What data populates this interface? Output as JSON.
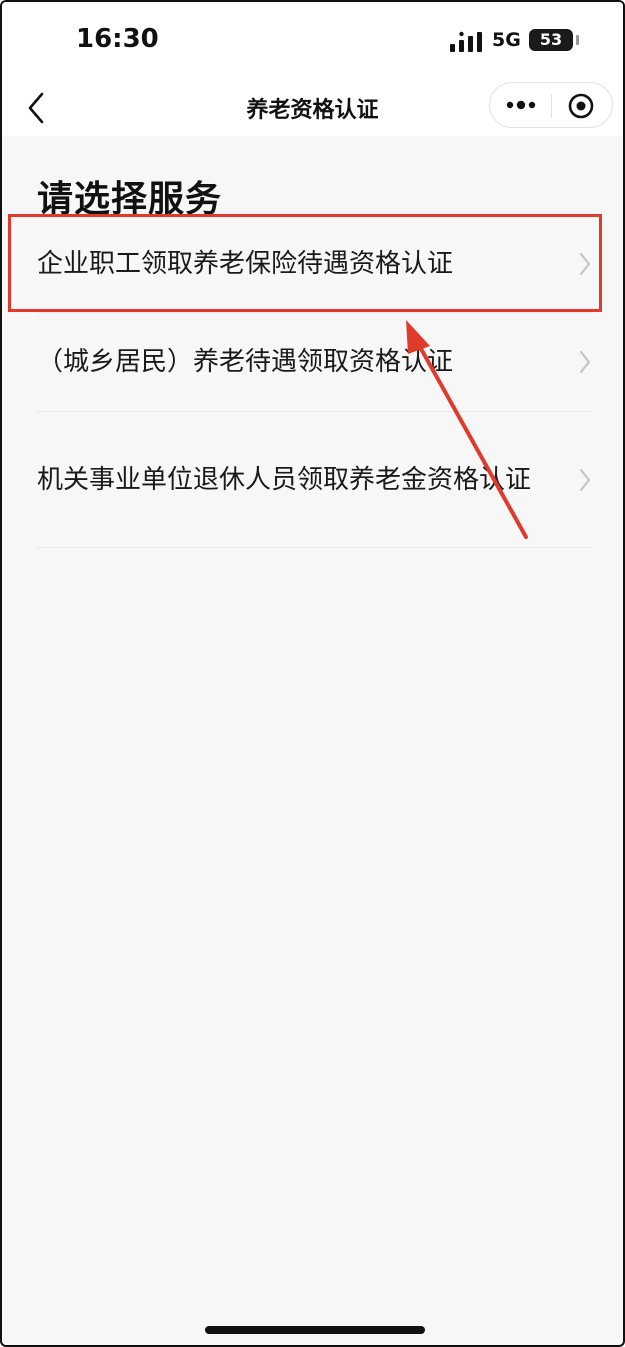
{
  "status_bar": {
    "time": "16:30",
    "network": "5G",
    "battery": "53",
    "signal_icon": "signal-bars-icon"
  },
  "nav": {
    "title": "养老资格认证",
    "back_icon": "chevron-left-icon",
    "more_icon": "more-dots-icon",
    "close_icon": "target-circle-icon"
  },
  "page": {
    "title": "请选择服务"
  },
  "services": [
    {
      "label": "企业职工领取养老保险待遇资格认证"
    },
    {
      "label": "（城乡居民）养老待遇领取资格认证"
    },
    {
      "label": "机关事业单位退休人员领取养老金资格认证"
    }
  ],
  "colors": {
    "highlight": "#e03a2c",
    "background": "#f7f7f7",
    "text": "#1a1a1a",
    "divider": "#e8e8e8",
    "chevron": "#c4c4c4"
  }
}
